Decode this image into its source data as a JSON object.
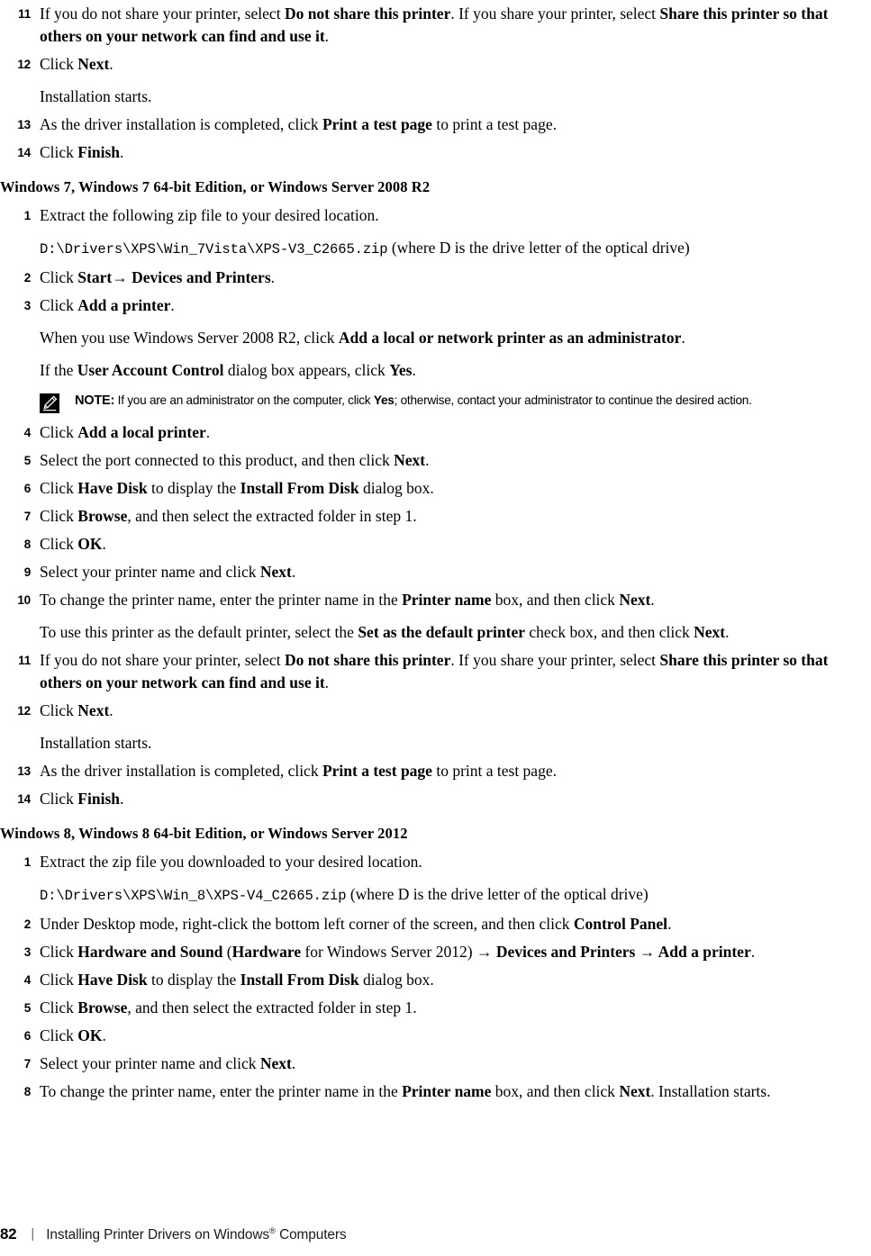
{
  "page": {
    "number": "82",
    "footer_separator": "|",
    "footer_title_pre": "Installing Printer Drivers on Windows",
    "footer_title_sup": "®",
    "footer_title_post": " Computers"
  },
  "blocks": {
    "vista_tail": {
      "step11": {
        "num": "11",
        "t1": "If you do not share your printer, select ",
        "b1": "Do not share this printer",
        "t2": ". If you share your printer, select ",
        "b2": "Share this printer so that others on your network can find and use it",
        "t3": "."
      },
      "step12": {
        "num": "12",
        "t1": "Click ",
        "b1": "Next",
        "t2": ".",
        "p2": "Installation starts."
      },
      "step13": {
        "num": "13",
        "t1": "As the driver installation is completed, click ",
        "b1": "Print a test page",
        "t2": " to print a test page."
      },
      "step14": {
        "num": "14",
        "t1": "Click ",
        "b1": "Finish",
        "t2": "."
      }
    },
    "win7": {
      "heading": "Windows 7, Windows 7 64-bit Edition, or Windows Server 2008 R2",
      "step1": {
        "num": "1",
        "t1": "Extract the following zip file to your desired location.",
        "code": "D:\\Drivers\\XPS\\Win_7Vista\\XPS-V3_C2665.zip",
        "t2": " (where D is the drive letter of the optical drive)"
      },
      "step2": {
        "num": "2",
        "t1": "Click ",
        "b1": "Start",
        "arrow": "→",
        "b2": " Devices and Printers",
        "t2": "."
      },
      "step3": {
        "num": "3",
        "t1": "Click ",
        "b1": "Add a printer",
        "t2": ".",
        "p2_t1": "When you use Windows Server 2008 R2, click ",
        "p2_b1": "Add a local or network printer as an administrator",
        "p2_t2": ".",
        "p3_t1": "If the ",
        "p3_b1": "User Account Control",
        "p3_t2": " dialog box appears, click ",
        "p3_b2": "Yes",
        "p3_t3": "."
      },
      "note": {
        "icon": "note-pencil-icon",
        "label": "NOTE:",
        "t1": " If you are an administrator on the computer, click ",
        "b1": "Yes",
        "t2": "; otherwise, contact your administrator to continue the desired action."
      },
      "step4": {
        "num": "4",
        "t1": "Click ",
        "b1": "Add a local printer",
        "t2": "."
      },
      "step5": {
        "num": "5",
        "t1": "Select the port connected to this product, and then click ",
        "b1": "Next",
        "t2": "."
      },
      "step6": {
        "num": "6",
        "t1": "Click ",
        "b1": "Have Disk",
        "t2": " to display the ",
        "b2": "Install From Disk",
        "t3": " dialog box."
      },
      "step7": {
        "num": "7",
        "t1": "Click ",
        "b1": "Browse",
        "t2": ", and then select the extracted folder in step 1."
      },
      "step8": {
        "num": "8",
        "t1": "Click ",
        "b1": "OK",
        "t2": "."
      },
      "step9": {
        "num": "9",
        "t1": "Select your printer name and click ",
        "b1": "Next",
        "t2": "."
      },
      "step10": {
        "num": "10",
        "t1": "To change the printer name, enter the printer name in the ",
        "b1": "Printer name",
        "t2": " box, and then click ",
        "b2": "Next",
        "t3": ".",
        "p2_t1": "To use this printer as the default printer, select the ",
        "p2_b1": "Set as the default printer",
        "p2_t2": " check box, and then click ",
        "p2_b2": "Next",
        "p2_t3": "."
      },
      "step11": {
        "num": "11",
        "t1": "If you do not share your printer, select ",
        "b1": "Do not share this printer",
        "t2": ". If you share your printer, select ",
        "b2": "Share this printer so that others on your network can find and use it",
        "t3": "."
      },
      "step12": {
        "num": "12",
        "t1": "Click ",
        "b1": "Next",
        "t2": ".",
        "p2": "Installation starts."
      },
      "step13": {
        "num": "13",
        "t1": "As the driver installation is completed, click ",
        "b1": "Print a test page",
        "t2": " to print a test page."
      },
      "step14": {
        "num": "14",
        "t1": "Click ",
        "b1": "Finish",
        "t2": "."
      }
    },
    "win8": {
      "heading": "Windows 8, Windows 8 64-bit Edition, or Windows Server 2012",
      "step1": {
        "num": "1",
        "t1": "Extract the zip file you downloaded to your desired location.",
        "code": "D:\\Drivers\\XPS\\Win_8\\XPS-V4_C2665.zip",
        "t2": " (where D is the drive letter of the optical drive)"
      },
      "step2": {
        "num": "2",
        "t1": "Under Desktop mode, right-click the bottom left corner of the screen, and then click ",
        "b1": "Control Panel",
        "t2": "."
      },
      "step3": {
        "num": "3",
        "t1": "Click ",
        "b1": "Hardware and Sound",
        "t2": " (",
        "b2": "Hardware",
        "t3": " for Windows Server 2012) ",
        "arrow1": "→",
        "b3": " Devices and Printers",
        "arrow2": " →",
        "b4": " Add a printer",
        "t4": "."
      },
      "step4": {
        "num": "4",
        "t1": "Click ",
        "b1": "Have Disk",
        "t2": " to display the ",
        "b2": "Install From Disk",
        "t3": " dialog box."
      },
      "step5": {
        "num": "5",
        "t1": "Click ",
        "b1": "Browse",
        "t2": ", and then select the extracted folder in step 1."
      },
      "step6": {
        "num": "6",
        "t1": "Click ",
        "b1": "OK",
        "t2": "."
      },
      "step7": {
        "num": "7",
        "t1": "Select your printer name and click ",
        "b1": "Next",
        "t2": "."
      },
      "step8": {
        "num": "8",
        "t1": "To change the printer name, enter the printer name in the ",
        "b1": "Printer name",
        "t2": " box, and then click ",
        "b2": "Next",
        "t3": ". Installation starts."
      }
    }
  }
}
